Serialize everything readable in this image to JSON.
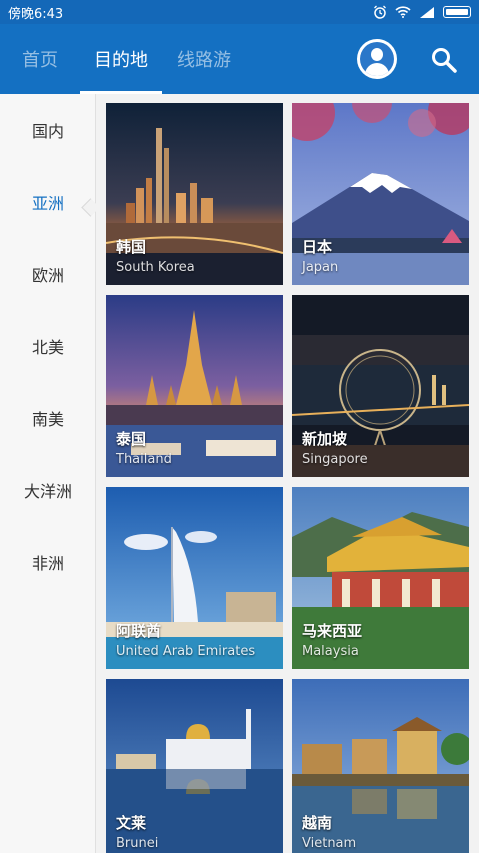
{
  "status": {
    "time": "傍晚6:43"
  },
  "tabs": [
    {
      "label": "首页"
    },
    {
      "label": "目的地",
      "active": true
    },
    {
      "label": "线路游"
    }
  ],
  "sidebar": {
    "items": [
      {
        "label": "国内"
      },
      {
        "label": "亚洲",
        "active": true
      },
      {
        "label": "欧洲"
      },
      {
        "label": "北美"
      },
      {
        "label": "南美"
      },
      {
        "label": "大洋洲"
      },
      {
        "label": "非洲"
      }
    ]
  },
  "destinations": [
    {
      "cn": "韩国",
      "en": "South Korea"
    },
    {
      "cn": "日本",
      "en": "Japan"
    },
    {
      "cn": "泰国",
      "en": "Thailand"
    },
    {
      "cn": "新加坡",
      "en": "Singapore"
    },
    {
      "cn": "阿联酋",
      "en": "United Arab Emirates"
    },
    {
      "cn": "马来西亚",
      "en": "Malaysia"
    },
    {
      "cn": "文莱",
      "en": "Brunei"
    },
    {
      "cn": "越南",
      "en": "Vietnam"
    }
  ],
  "colors": {
    "primary": "#1470c2",
    "active_side": "#1470c2"
  }
}
